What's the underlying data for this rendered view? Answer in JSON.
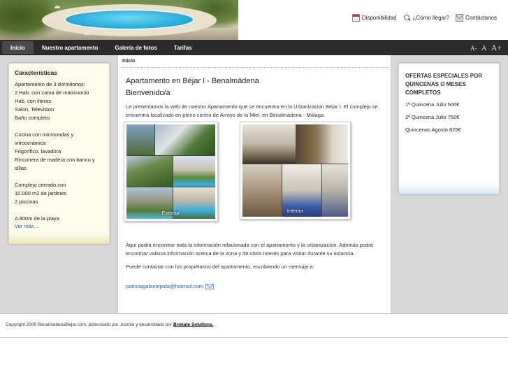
{
  "topnav": {
    "availability": "Disponibilidad",
    "directions": "¿Cómo llegar?",
    "contact": "Contáctanos"
  },
  "mainnav": {
    "items": [
      "Inicio",
      "Nuestro apartamento",
      "Galería de fotos",
      "Tarifas"
    ],
    "active": "Inicio"
  },
  "fontsize": [
    "A-",
    "A",
    "A+"
  ],
  "left": {
    "title": "Características",
    "lines1": [
      "Apartamento de 3 dormitorios:",
      "2 Hab. con cama de matrimonio",
      "Hab. con literas",
      "Salon, Television",
      "Baño completo"
    ],
    "lines2": [
      "Cocina con microondas y",
      "vitrocerámica",
      "Frigorífico, lavadora",
      "Rinconera de madera con banco y",
      "sillas"
    ],
    "lines3": [
      "Complejo cerrado con",
      "10.000 m2 de jardines",
      "2 piscinas"
    ],
    "lines4": [
      "A 800m de la playa"
    ],
    "more": "Ver más ..."
  },
  "center": {
    "breadcrumb": "Inicio",
    "title": "Apartamento en Béjar I - Benalmádena",
    "subtitle": "Bienvenido/a",
    "intro": "Le presentamos la web de nuestro Apartamento que se encuentra en la Urbanizacion Béjar I. El complejo se encuentra localizado en pleno centro de  Arroyo de la Miel, en Benalmádena - Málaga.",
    "photo_exterior": "Exterior",
    "photo_interior": "Interior",
    "para1": "Aquí podrá encontrar toda la información relacionada con el apartamento y la urbanizacion. Además podrá encontrar valiosa información acerca de la zona y de sitios interés para visitar durante su estancia.",
    "para2": "Puede contactar con los propietarios del apartamento, escribiendo un mensaje a:",
    "email": "patriciagalantejeda@hotmail.com"
  },
  "right": {
    "title": "OFERTAS ESPECIALES POR QUINCENAS O MESES COMPLETOS",
    "offers": [
      "1ª Quincena Julio 500€",
      "2ª Quincena Julio 750€",
      "Quincenas Agosto 825€"
    ]
  },
  "footer": {
    "text": "Copyright 2009 BenalmadenaBejar.com, potenciado por Joomla y desarrollado por",
    "link": "Brokate Solutions."
  }
}
